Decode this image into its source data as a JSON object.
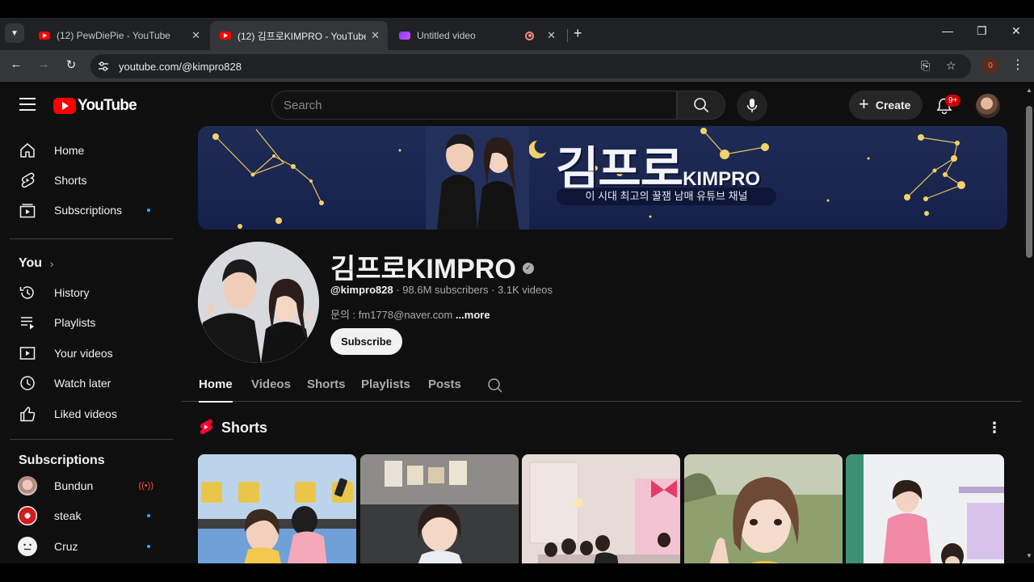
{
  "browser": {
    "tabs": [
      {
        "title": "(12) PewDiePie - YouTube",
        "close": "✕"
      },
      {
        "title": "(12) 김프로KIMPRO - YouTube",
        "close": "✕"
      },
      {
        "title": "Untitled video",
        "close": "✕"
      }
    ],
    "new_tab": "+",
    "window_controls": {
      "minimize": "—",
      "restore": "❐",
      "close": "✕"
    },
    "url": "youtube.com/@kimpro828",
    "extension_badge": "0"
  },
  "masthead": {
    "logo_text": "YouTube",
    "search_placeholder": "Search",
    "create_label": "Create",
    "notification_count": "9+"
  },
  "sidebar": {
    "main": [
      {
        "label": "Home",
        "icon": "home-icon"
      },
      {
        "label": "Shorts",
        "icon": "shorts-icon"
      },
      {
        "label": "Subscriptions",
        "icon": "subscriptions-icon"
      }
    ],
    "you_header": "You",
    "you_items": [
      {
        "label": "History",
        "icon": "history-icon"
      },
      {
        "label": "Playlists",
        "icon": "playlists-icon"
      },
      {
        "label": "Your videos",
        "icon": "your-videos-icon"
      },
      {
        "label": "Watch later",
        "icon": "watch-later-icon"
      },
      {
        "label": "Liked videos",
        "icon": "liked-videos-icon"
      }
    ],
    "subscriptions_header": "Subscriptions",
    "subscriptions": [
      {
        "label": "Bundun",
        "status": "live"
      },
      {
        "label": "steak",
        "status": "new"
      },
      {
        "label": "Cruz",
        "status": "new"
      }
    ]
  },
  "channel": {
    "banner_title": "김프로",
    "banner_title_en": "KIMPRO",
    "banner_subtitle": "이 시대 최고의 꿀잼 남매 유튜브 채널",
    "name": "김프로KIMPRO",
    "handle": "@kimpro828",
    "stats": " · 98.6M subscribers · 3.1K videos",
    "description": "문의 : fm1778@naver.com",
    "more": "...more",
    "subscribe_label": "Subscribe",
    "tabs": [
      "Home",
      "Videos",
      "Shorts",
      "Playlists",
      "Posts"
    ],
    "active_tab": "Home"
  },
  "shorts_section": {
    "title": "Shorts"
  },
  "colors": {
    "yt_bg": "#0f0f0f",
    "yt_red": "#ff0000",
    "accent_blue": "#3ea6ff",
    "banner_navy": "#1e2b55"
  }
}
